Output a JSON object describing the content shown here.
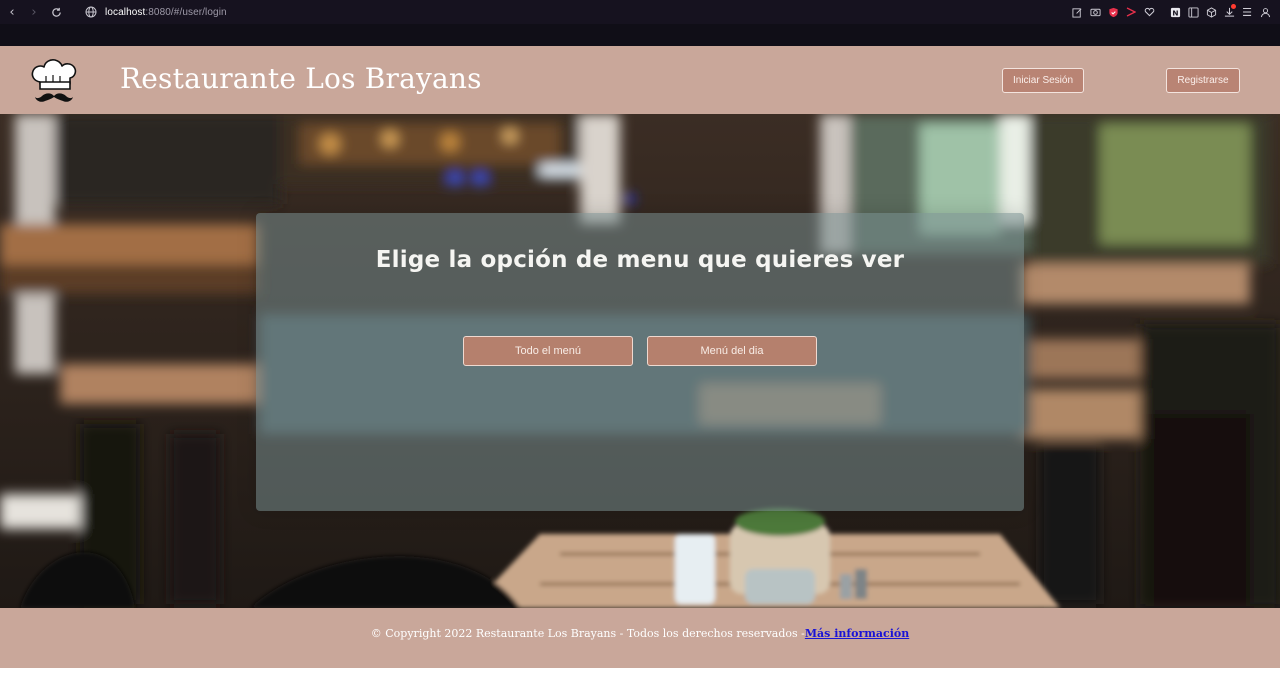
{
  "browser": {
    "url_host": "localhost",
    "url_rest": ":8080/#/user/login",
    "icons": [
      "back-icon",
      "forward-icon",
      "reload-icon",
      "globe-icon",
      "edit-icon",
      "camera-icon",
      "shield-icon",
      "play-icon",
      "heart-icon",
      "notion-icon",
      "reader-icon",
      "cube-icon",
      "download-icon",
      "menu-icon",
      "profile-icon"
    ]
  },
  "header": {
    "title": "Restaurante Los Brayans",
    "logo_icon": "chef-hat-mustache-icon",
    "login_label": "Iniciar Sesión",
    "register_label": "Registrarse"
  },
  "hero": {
    "heading": "Elige la opción de menu que quieres ver",
    "buttons": {
      "all_menu": "Todo el menú",
      "daily_menu": "Menú del dia"
    }
  },
  "footer": {
    "text": "© Copyright 2022 Restaurante Los Brayans - Todos los derechos reservados -",
    "link": "Más información"
  },
  "colors": {
    "header_bg": "#c9a79a",
    "button_bg": "#b98474",
    "link": "#1a13d6",
    "browser_bg": "#16121f"
  }
}
